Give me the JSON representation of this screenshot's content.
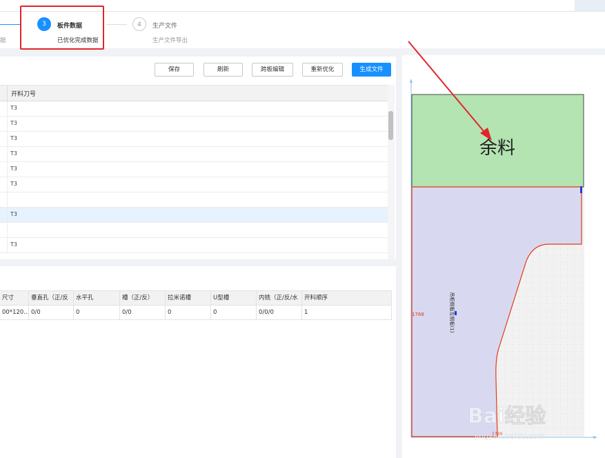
{
  "steps": {
    "prev": {
      "desc": "据"
    },
    "current": {
      "number": "3",
      "title": "板件数据",
      "desc": "已优化完成数据"
    },
    "next": {
      "number": "4",
      "title": "生产文件",
      "desc": "生产文件导出"
    }
  },
  "toolbar": {
    "save": "保存",
    "refresh": "刷新",
    "cross_edit": "跨板编辑",
    "reoptimize": "重新优化",
    "generate": "生成文件"
  },
  "grid": {
    "column": "开料刀号",
    "rows": [
      "T3",
      "T3",
      "T3",
      "T3",
      "T3",
      "T3",
      "",
      "T3",
      "",
      "T3"
    ],
    "selected_index": 7
  },
  "details": {
    "headers": [
      "尺寸",
      "垂直孔（正/反",
      "水平孔",
      "槽（正/反）",
      "拉米诺槽",
      "U型槽",
      "内铣（正/反/水",
      "开料顺序"
    ],
    "row": [
      "00*120...",
      "0/0",
      "0",
      "0/0",
      "0",
      "0",
      "0/0/0",
      "1"
    ]
  },
  "preview": {
    "remnant_label": "余料",
    "dimension_left": "1768",
    "dimension_bottom": "1220",
    "part_label": "吊柜侧板左侧板(1)"
  },
  "watermark": {
    "text": "Bai经验",
    "url": "jingyan.baidu.com"
  },
  "colors": {
    "accent": "#1890ff",
    "annotation": "#e1252b",
    "remnant": "#b3e4b1",
    "part": "#d8d9f1"
  }
}
